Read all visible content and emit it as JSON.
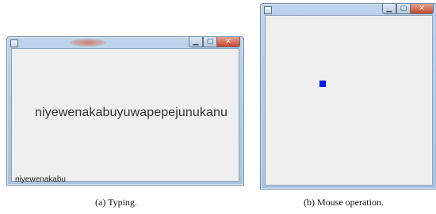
{
  "figure_a": {
    "typed_text": "niyewenakabuyuwapepejunukanu",
    "input_text": "niyewenakabu",
    "caption": "(a)  Typing."
  },
  "figure_b": {
    "caption": "(b)  Mouse operation.",
    "marker_color": "#0018f0"
  },
  "window_controls": {
    "minimize": "▁",
    "maximize": "▢",
    "close": "✕"
  },
  "icons": [
    "app-window-icon",
    "minimize-icon",
    "maximize-icon",
    "close-icon"
  ]
}
